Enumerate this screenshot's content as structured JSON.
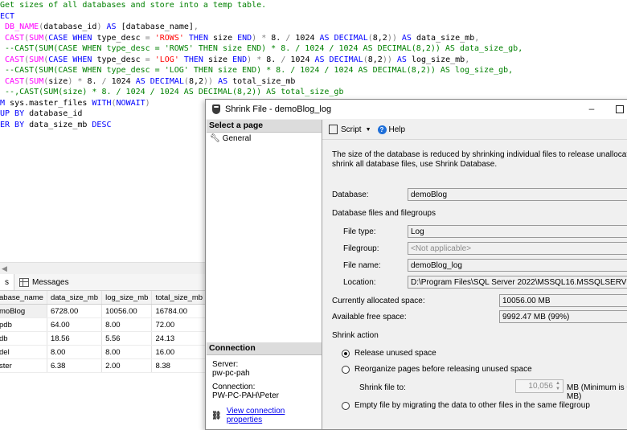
{
  "editor": {
    "lines": [
      [
        {
          "c": "cm",
          "t": "Get sizes of all databases and store into a temp table."
        }
      ],
      [
        {
          "c": "kw",
          "t": "ECT"
        }
      ],
      [
        {
          "c": "tx",
          "t": " "
        },
        {
          "c": "fn",
          "t": "DB_NAME"
        },
        {
          "c": "op",
          "t": "("
        },
        {
          "c": "tx",
          "t": "database_id"
        },
        {
          "c": "op",
          "t": ")"
        },
        {
          "c": "tx",
          "t": " "
        },
        {
          "c": "kw",
          "t": "AS"
        },
        {
          "c": "tx",
          "t": " [database_name]"
        },
        {
          "c": "op",
          "t": ","
        }
      ],
      [
        {
          "c": "tx",
          "t": " "
        },
        {
          "c": "fn",
          "t": "CAST"
        },
        {
          "c": "op",
          "t": "("
        },
        {
          "c": "fn",
          "t": "SUM"
        },
        {
          "c": "op",
          "t": "("
        },
        {
          "c": "kw",
          "t": "CASE WHEN"
        },
        {
          "c": "tx",
          "t": " type_desc "
        },
        {
          "c": "op",
          "t": "="
        },
        {
          "c": "tx",
          "t": " "
        },
        {
          "c": "str",
          "t": "'ROWS'"
        },
        {
          "c": "tx",
          "t": " "
        },
        {
          "c": "kw",
          "t": "THEN"
        },
        {
          "c": "tx",
          "t": " size "
        },
        {
          "c": "kw",
          "t": "END"
        },
        {
          "c": "op",
          "t": ")"
        },
        {
          "c": "tx",
          "t": " "
        },
        {
          "c": "op",
          "t": "*"
        },
        {
          "c": "tx",
          "t": " 8. "
        },
        {
          "c": "op",
          "t": "/"
        },
        {
          "c": "tx",
          "t": " 1024 "
        },
        {
          "c": "kw",
          "t": "AS DECIMAL"
        },
        {
          "c": "op",
          "t": "("
        },
        {
          "c": "tx",
          "t": "8,2"
        },
        {
          "c": "op",
          "t": "))"
        },
        {
          "c": "tx",
          "t": " "
        },
        {
          "c": "kw",
          "t": "AS"
        },
        {
          "c": "tx",
          "t": " data_size_mb"
        },
        {
          "c": "op",
          "t": ","
        }
      ],
      [
        {
          "c": "tx",
          "t": " "
        },
        {
          "c": "cm",
          "t": "--CAST(SUM(CASE WHEN type_desc = 'ROWS' THEN size END) * 8. / 1024 / 1024 AS DECIMAL(8,2)) AS data_size_gb,"
        }
      ],
      [
        {
          "c": "tx",
          "t": " "
        },
        {
          "c": "fn",
          "t": "CAST"
        },
        {
          "c": "op",
          "t": "("
        },
        {
          "c": "fn",
          "t": "SUM"
        },
        {
          "c": "op",
          "t": "("
        },
        {
          "c": "kw",
          "t": "CASE WHEN"
        },
        {
          "c": "tx",
          "t": " type_desc "
        },
        {
          "c": "op",
          "t": "="
        },
        {
          "c": "tx",
          "t": " "
        },
        {
          "c": "str",
          "t": "'LOG'"
        },
        {
          "c": "tx",
          "t": " "
        },
        {
          "c": "kw",
          "t": "THEN"
        },
        {
          "c": "tx",
          "t": " size "
        },
        {
          "c": "kw",
          "t": "END"
        },
        {
          "c": "op",
          "t": ")"
        },
        {
          "c": "tx",
          "t": " "
        },
        {
          "c": "op",
          "t": "*"
        },
        {
          "c": "tx",
          "t": " 8. "
        },
        {
          "c": "op",
          "t": "/"
        },
        {
          "c": "tx",
          "t": " 1024 "
        },
        {
          "c": "kw",
          "t": "AS DECIMAL"
        },
        {
          "c": "op",
          "t": "("
        },
        {
          "c": "tx",
          "t": "8,2"
        },
        {
          "c": "op",
          "t": "))"
        },
        {
          "c": "tx",
          "t": " "
        },
        {
          "c": "kw",
          "t": "AS"
        },
        {
          "c": "tx",
          "t": " log_size_mb"
        },
        {
          "c": "op",
          "t": ","
        }
      ],
      [
        {
          "c": "tx",
          "t": " "
        },
        {
          "c": "cm",
          "t": "--CAST(SUM(CASE WHEN type_desc = 'LOG' THEN size END) * 8. / 1024 / 1024 AS DECIMAL(8,2)) AS log_size_gb,"
        }
      ],
      [
        {
          "c": "tx",
          "t": " "
        },
        {
          "c": "fn",
          "t": "CAST"
        },
        {
          "c": "op",
          "t": "("
        },
        {
          "c": "fn",
          "t": "SUM"
        },
        {
          "c": "op",
          "t": "("
        },
        {
          "c": "tx",
          "t": "size"
        },
        {
          "c": "op",
          "t": ")"
        },
        {
          "c": "tx",
          "t": " "
        },
        {
          "c": "op",
          "t": "*"
        },
        {
          "c": "tx",
          "t": " 8. "
        },
        {
          "c": "op",
          "t": "/"
        },
        {
          "c": "tx",
          "t": " 1024 "
        },
        {
          "c": "kw",
          "t": "AS DECIMAL"
        },
        {
          "c": "op",
          "t": "("
        },
        {
          "c": "tx",
          "t": "8,2"
        },
        {
          "c": "op",
          "t": "))"
        },
        {
          "c": "tx",
          "t": " "
        },
        {
          "c": "kw",
          "t": "AS"
        },
        {
          "c": "tx",
          "t": " total_size_mb"
        }
      ],
      [
        {
          "c": "tx",
          "t": " "
        },
        {
          "c": "cm",
          "t": "--,CAST(SUM(size) * 8. / 1024 / 1024 AS DECIMAL(8,2)) AS total_size_gb"
        }
      ],
      [
        {
          "c": "kw",
          "t": "M"
        },
        {
          "c": "tx",
          "t": " sys.master_files "
        },
        {
          "c": "kw",
          "t": "WITH"
        },
        {
          "c": "op",
          "t": "("
        },
        {
          "c": "kw",
          "t": "NOWAIT"
        },
        {
          "c": "op",
          "t": ")"
        }
      ],
      [
        {
          "c": "kw",
          "t": "UP BY"
        },
        {
          "c": "tx",
          "t": " database_id"
        }
      ],
      [
        {
          "c": "kw",
          "t": "ER BY"
        },
        {
          "c": "tx",
          "t": " data_size_mb "
        },
        {
          "c": "kw",
          "t": "DESC"
        }
      ]
    ]
  },
  "results": {
    "tab_results": "s",
    "tab_messages": "Messages",
    "columns": [
      "abase_name",
      "data_size_mb",
      "log_size_mb",
      "total_size_mb"
    ],
    "rows": [
      [
        "moBlog",
        "6728.00",
        "10056.00",
        "16784.00"
      ],
      [
        "pdb",
        "64.00",
        "8.00",
        "72.00"
      ],
      [
        "db",
        "18.56",
        "5.56",
        "24.13"
      ],
      [
        "del",
        "8.00",
        "8.00",
        "16.00"
      ],
      [
        "ster",
        "6.38",
        "2.00",
        "8.38"
      ]
    ]
  },
  "dialog": {
    "title": "Shrink File - demoBlog_log",
    "minimize": "–",
    "select_page": "Select a page",
    "page_general": "General",
    "connection_header": "Connection",
    "server_label": "Server:",
    "server_value": "pw-pc-pah",
    "connection_label": "Connection:",
    "connection_value": "PW-PC-PAH\\Peter",
    "view_connection": "View connection properties",
    "script_label": "Script",
    "help_label": "Help",
    "desc_line1": "The size of the database is reduced by shrinking individual files to release unallocated spa",
    "desc_line2": "shrink all database files, use Shrink Database.",
    "database_label": "Database:",
    "database_value": "demoBlog",
    "files_group": "Database files and filegroups",
    "filetype_label": "File type:",
    "filetype_value": "Log",
    "filegroup_label": "Filegroup:",
    "filegroup_value": "<Not applicable>",
    "filename_label": "File name:",
    "filename_value": "demoBlog_log",
    "location_label": "Location:",
    "location_value": "D:\\Program Files\\SQL Server 2022\\MSSQL16.MSSQLSERVER\\MSS",
    "allocated_label": "Currently allocated space:",
    "allocated_value": "10056.00 MB",
    "free_label": "Available free space:",
    "free_value": "9992.47 MB (99%)",
    "shrink_action": "Shrink action",
    "opt_release": "Release unused space",
    "opt_reorganize": "Reorganize pages before releasing unused space",
    "shrink_to_label": "Shrink file to:",
    "shrink_to_value": "10,056",
    "shrink_to_unit": "MB (Minimum is 0 MB)",
    "opt_empty": "Empty file by migrating the data to other files in the same filegroup"
  }
}
